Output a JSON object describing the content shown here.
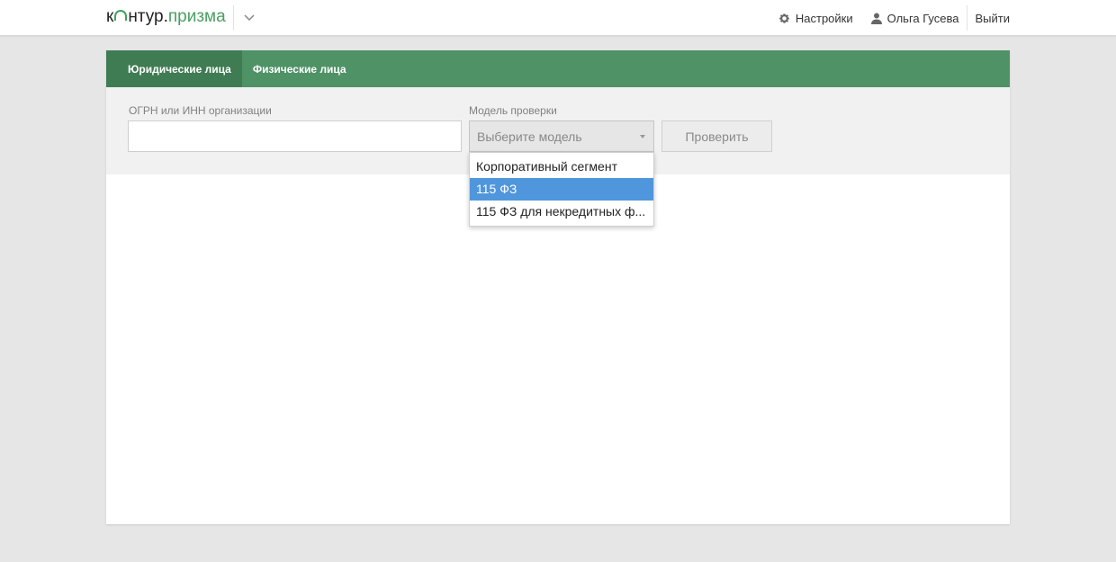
{
  "header": {
    "logo_prefix": "к",
    "logo_middle": "нтур",
    "logo_dot": ".",
    "logo_suffix": "призма",
    "settings_label": "Настройки",
    "user_name": "Ольга Гусева",
    "logout_label": "Выйти"
  },
  "tabs": [
    {
      "label": "Юридические лица",
      "active": true
    },
    {
      "label": "Физические лица",
      "active": false
    }
  ],
  "form": {
    "org_label": "ОГРН или ИНН организации",
    "org_value": "",
    "model_label": "Модель проверки",
    "model_placeholder": "Выберите модель",
    "check_button": "Проверить"
  },
  "dropdown": {
    "options": [
      "Корпоративный сегмент",
      "115 ФЗ",
      "115 ФЗ для некредитных ф..."
    ],
    "highlighted_index": 1
  },
  "colors": {
    "brand_green": "#47a060",
    "tab_bar": "#4f9266",
    "tab_active": "#3f7c53",
    "highlight_blue": "#4f96dc"
  }
}
